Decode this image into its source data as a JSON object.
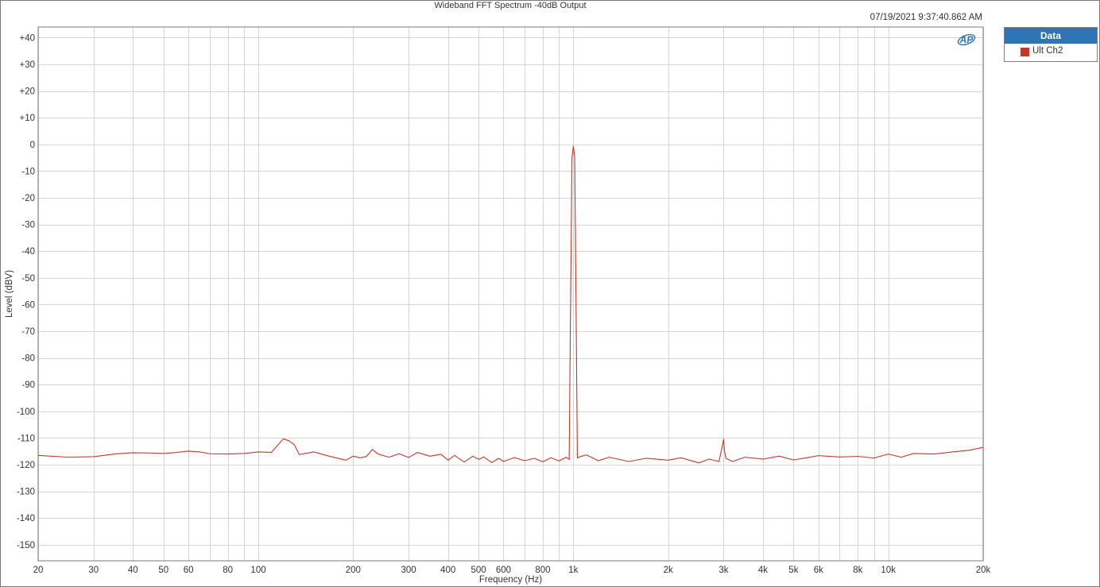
{
  "title": "Wideband FFT Spectrum -40dB Output",
  "timestamp": "07/19/2021 9:37:40.862 AM",
  "logo": {
    "icon": "ap-logo-icon",
    "text": "AP",
    "color": "#2e75b6"
  },
  "legend": {
    "header": "Data",
    "items": [
      {
        "label": "Ult Ch2",
        "color": "#c0392b"
      }
    ]
  },
  "colors": {
    "trace": "#c0392b",
    "grid": "#d4d4d4",
    "legend_header": "#2e75b6"
  },
  "chart_data": {
    "type": "line",
    "title": "Wideband FFT Spectrum -40dB Output",
    "xlabel": "Frequency (Hz)",
    "ylabel": "Level (dBV)",
    "xscale": "log",
    "xlim": [
      20,
      20000
    ],
    "ylim": [
      -156,
      44
    ],
    "grid": true,
    "legend_position": "outside-right",
    "x_ticks": [
      {
        "v": 20,
        "label": "20"
      },
      {
        "v": 30,
        "label": "30"
      },
      {
        "v": 40,
        "label": "40"
      },
      {
        "v": 50,
        "label": "50"
      },
      {
        "v": 60,
        "label": "60"
      },
      {
        "v": 80,
        "label": "80"
      },
      {
        "v": 100,
        "label": "100"
      },
      {
        "v": 200,
        "label": "200"
      },
      {
        "v": 300,
        "label": "300"
      },
      {
        "v": 400,
        "label": "400"
      },
      {
        "v": 500,
        "label": "500"
      },
      {
        "v": 600,
        "label": "600"
      },
      {
        "v": 800,
        "label": "800"
      },
      {
        "v": 1000,
        "label": "1k"
      },
      {
        "v": 2000,
        "label": "2k"
      },
      {
        "v": 3000,
        "label": "3k"
      },
      {
        "v": 4000,
        "label": "4k"
      },
      {
        "v": 5000,
        "label": "5k"
      },
      {
        "v": 6000,
        "label": "6k"
      },
      {
        "v": 8000,
        "label": "8k"
      },
      {
        "v": 10000,
        "label": "10k"
      },
      {
        "v": 20000,
        "label": "20k"
      }
    ],
    "x_minor_grid": [
      70,
      90,
      700,
      900,
      7000,
      9000
    ],
    "y_ticks": [
      {
        "v": 40,
        "label": "+40"
      },
      {
        "v": 30,
        "label": "+30"
      },
      {
        "v": 20,
        "label": "+20"
      },
      {
        "v": 10,
        "label": "+10"
      },
      {
        "v": 0,
        "label": "0"
      },
      {
        "v": -10,
        "label": "-10"
      },
      {
        "v": -20,
        "label": "-20"
      },
      {
        "v": -30,
        "label": "-30"
      },
      {
        "v": -40,
        "label": "-40"
      },
      {
        "v": -50,
        "label": "-50"
      },
      {
        "v": -60,
        "label": "-60"
      },
      {
        "v": -70,
        "label": "-70"
      },
      {
        "v": -80,
        "label": "-80"
      },
      {
        "v": -90,
        "label": "-90"
      },
      {
        "v": -100,
        "label": "-100"
      },
      {
        "v": -110,
        "label": "-110"
      },
      {
        "v": -120,
        "label": "-120"
      },
      {
        "v": -130,
        "label": "-130"
      },
      {
        "v": -140,
        "label": "-140"
      },
      {
        "v": -150,
        "label": "-150"
      }
    ],
    "series": [
      {
        "name": "Ult Ch2",
        "color": "#c0392b",
        "x": [
          20,
          25,
          30,
          35,
          40,
          45,
          50,
          55,
          60,
          65,
          70,
          80,
          90,
          100,
          110,
          120,
          125,
          130,
          135,
          150,
          170,
          190,
          200,
          210,
          220,
          230,
          240,
          260,
          280,
          300,
          320,
          350,
          380,
          400,
          420,
          450,
          480,
          500,
          520,
          550,
          580,
          600,
          650,
          700,
          750,
          800,
          850,
          900,
          950,
          970,
          980,
          990,
          1000,
          1010,
          1020,
          1030,
          1050,
          1100,
          1200,
          1300,
          1500,
          1700,
          2000,
          2200,
          2500,
          2700,
          2900,
          3000,
          3020,
          3050,
          3200,
          3500,
          4000,
          4500,
          5000,
          5500,
          6000,
          7000,
          8000,
          9000,
          10000,
          11000,
          12000,
          14000,
          16000,
          18000,
          20000
        ],
        "y": [
          -116.5,
          -117.2,
          -117.0,
          -116.0,
          -115.5,
          -115.6,
          -115.8,
          -115.4,
          -114.9,
          -115.2,
          -115.9,
          -116.0,
          -115.8,
          -115.2,
          -115.4,
          -110.3,
          -111.0,
          -112.5,
          -116.2,
          -115.2,
          -117.0,
          -118.3,
          -116.8,
          -117.4,
          -117.0,
          -114.3,
          -116.0,
          -117.2,
          -115.9,
          -117.3,
          -115.4,
          -116.8,
          -116.1,
          -118.3,
          -116.5,
          -119.0,
          -116.8,
          -118.0,
          -117.1,
          -119.2,
          -117.6,
          -118.8,
          -117.3,
          -118.5,
          -117.6,
          -118.9,
          -117.4,
          -118.6,
          -117.2,
          -118.0,
          -60.0,
          -5.0,
          -0.6,
          -5.0,
          -60.0,
          -117.5,
          -117.0,
          -116.3,
          -118.5,
          -117.2,
          -118.8,
          -117.6,
          -118.3,
          -117.4,
          -119.3,
          -117.9,
          -118.8,
          -110.5,
          -115.0,
          -117.6,
          -118.8,
          -117.2,
          -117.9,
          -116.8,
          -118.2,
          -117.4,
          -116.6,
          -117.1,
          -116.9,
          -117.5,
          -116.0,
          -117.2,
          -115.8,
          -116.0,
          -115.2,
          -114.6,
          -113.5
        ]
      }
    ]
  }
}
